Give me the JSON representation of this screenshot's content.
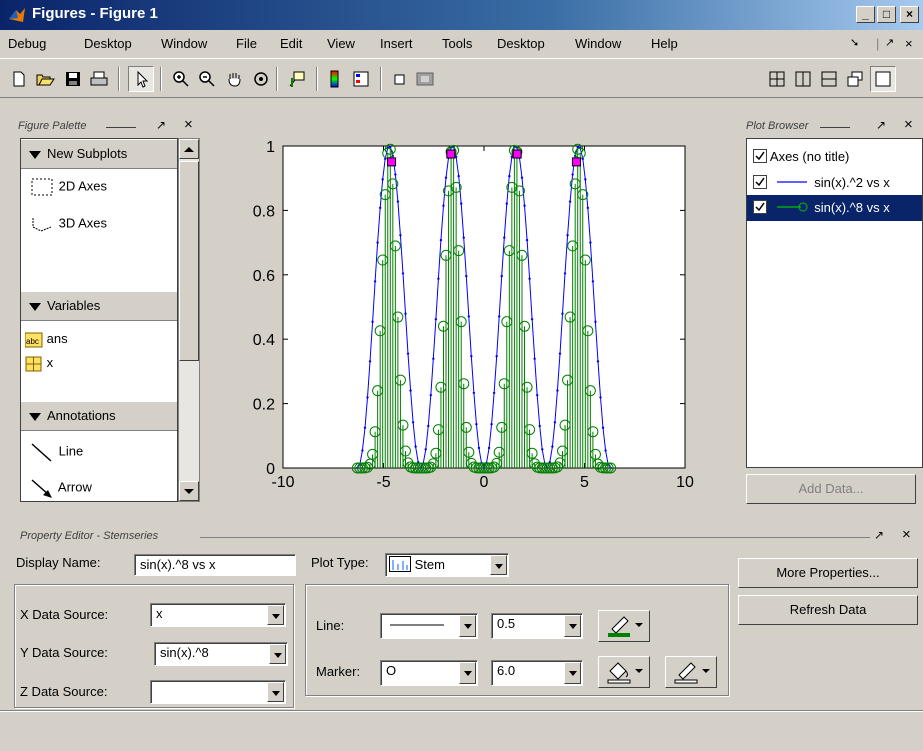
{
  "window": {
    "title": "Figures - Figure 1"
  },
  "menu": [
    "Debug",
    "Desktop",
    "Window",
    "File",
    "Edit",
    "View",
    "Insert",
    "Tools",
    "Desktop",
    "Window",
    "Help"
  ],
  "palette": {
    "title": "Figure Palette",
    "sections": {
      "subplots": {
        "label": "New Subplots",
        "items": [
          "2D Axes",
          "3D Axes"
        ]
      },
      "variables": {
        "label": "Variables",
        "items": [
          "ans",
          "x"
        ]
      },
      "annotations": {
        "label": "Annotations",
        "items": [
          "Line",
          "Arrow"
        ]
      }
    }
  },
  "browser": {
    "title": "Plot Browser",
    "items": [
      "Axes (no title)",
      "sin(x).^2 vs x",
      "sin(x).^8 vs x"
    ],
    "add_data": "Add Data..."
  },
  "property_editor": {
    "title": "Property Editor - Stemseries",
    "display_name_label": "Display Name:",
    "display_name_value": "sin(x).^8 vs x",
    "plot_type_label": "Plot Type:",
    "plot_type_value": "Stem",
    "x_source_label": "X Data Source:",
    "x_source_value": "x",
    "y_source_label": "Y Data Source:",
    "y_source_value": "sin(x).^8",
    "z_source_label": "Z Data Source:",
    "z_source_value": "",
    "line_label": "Line:",
    "line_width": "0.5",
    "marker_label": "Marker:",
    "marker_symbol": "O",
    "marker_size": "6.0",
    "more_properties": "More Properties...",
    "refresh_data": "Refresh Data"
  },
  "colors": {
    "blue_series": "#0000ff",
    "green_series": "#008000",
    "magenta": "#ff00ff",
    "selection": "#0a246a"
  },
  "chart_data": {
    "type": "line",
    "xlim": [
      -10,
      10
    ],
    "ylim": [
      0,
      1
    ],
    "xticks": [
      "-10",
      "-5",
      "0",
      "5",
      "10"
    ],
    "yticks": [
      "0",
      "0.2",
      "0.4",
      "0.6",
      "0.8",
      "1"
    ],
    "x_domain": [
      -6.3,
      6.3
    ],
    "series": [
      {
        "name": "sin(x).^2 vs x",
        "kind": "line",
        "expr": "sin(x)^2",
        "color": "#0000ff"
      },
      {
        "name": "sin(x).^8 vs x",
        "kind": "stem",
        "expr": "sin(x)^8",
        "color": "#008000"
      }
    ]
  }
}
